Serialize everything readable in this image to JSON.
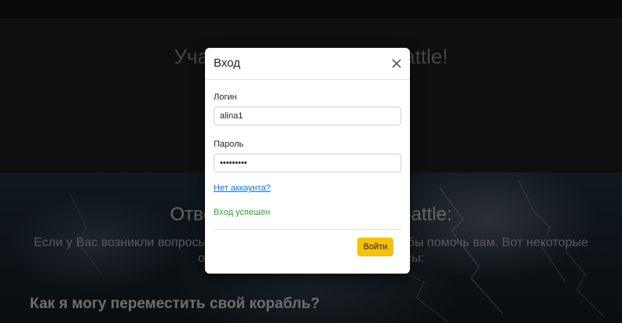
{
  "page": {
    "hero_title": "Участвуйте в игре Sea battle!",
    "faq_title": "Ответы на вопросы о Sea battle:",
    "faq_subtitle": "Если у Вас возникли вопросы об игре, мы находимся здесь, чтобы помочь вам. Вот некоторые ответы на часто задаваемые вопросы:",
    "faq_question": "Как я могу переместить свой корабль?"
  },
  "modal": {
    "title": "Вход",
    "close_icon": "close-icon",
    "login_label": "Логин",
    "login_value": "alina1",
    "password_label": "Пароль",
    "password_value": "•••••••••",
    "no_account_link": "Нет аккаунта?",
    "status": "Вход успешен",
    "submit_label": "Войти"
  },
  "colors": {
    "submit_button": "#f5c10a",
    "link": "#0d6efd",
    "status_success": "#2fa52f",
    "overlay": "rgba(0,0,0,0.5)"
  }
}
